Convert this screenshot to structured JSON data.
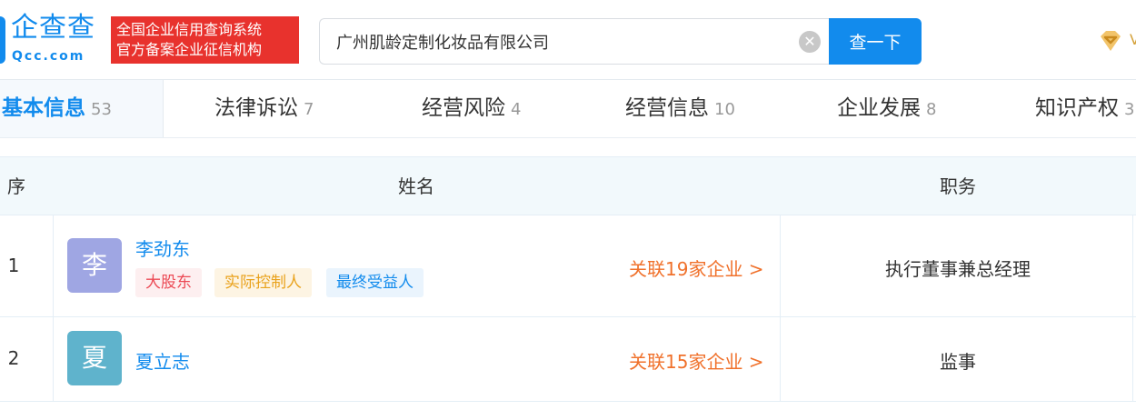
{
  "header": {
    "logo_text": "企查查",
    "logo_sub": "Qcc.com",
    "cert_line1": "全国企业信用查询系统",
    "cert_line2": "官方备案企业征信机构",
    "search_value": "广州肌龄定制化妆品有限公司",
    "clear_icon": "✕",
    "search_button": "查一下",
    "vip_icon": "diamond-icon",
    "more_glyph": "V"
  },
  "tabs": [
    {
      "label": "基本信息",
      "count": "53",
      "active": true
    },
    {
      "label": "法律诉讼",
      "count": "7"
    },
    {
      "label": "经营风险",
      "count": "4"
    },
    {
      "label": "经营信息",
      "count": "10"
    },
    {
      "label": "企业发展",
      "count": "8"
    },
    {
      "label": "知识产权",
      "count": "3"
    }
  ],
  "table": {
    "headers": {
      "index": "序号",
      "name": "姓名",
      "position": "职务"
    },
    "rows": [
      {
        "index": "1",
        "avatar_char": "李",
        "avatar_color": "#9fa6e3",
        "name": "李劲东",
        "tags": [
          "大股东",
          "实际控制人",
          "最终受益人"
        ],
        "related": "关联19家企业 >",
        "position": "执行董事兼总经理"
      },
      {
        "index": "2",
        "avatar_char": "夏",
        "avatar_color": "#5fb3cc",
        "name": "夏立志",
        "tags": [],
        "related": "关联15家企业 >",
        "position": "监事"
      }
    ]
  },
  "colors": {
    "brand": "#128bed",
    "cert_red": "#e8322d",
    "related_orange": "#f0712b"
  }
}
